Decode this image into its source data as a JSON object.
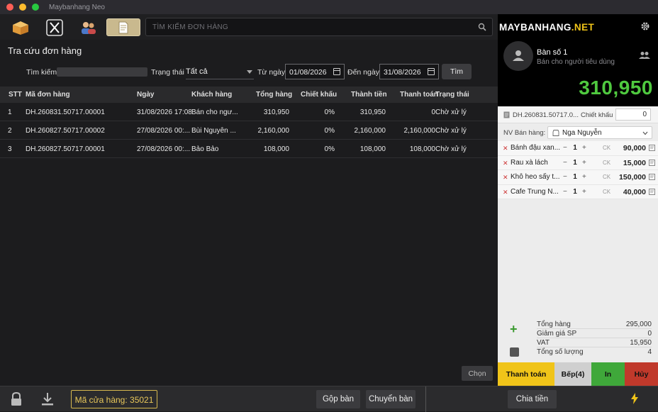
{
  "window": {
    "title": "Maybanhang Neo"
  },
  "toolbar": {
    "search_placeholder": "TÌM KIẾM ĐƠN HÀNG",
    "icons": [
      "box-icon",
      "utensils-icon",
      "users-icon",
      "orders-icon",
      "search-icon"
    ]
  },
  "page": {
    "title": "Tra cứu đơn hàng"
  },
  "filters": {
    "keyword_label": "Tìm kiếm",
    "status_label": "Trạng thái",
    "status_value": "Tất cả",
    "from_label": "Từ ngày",
    "from_value": "01/08/2026",
    "to_label": "Đến ngày",
    "to_value": "31/08/2026",
    "search_button": "Tìm"
  },
  "table": {
    "headers": [
      "STT",
      "Mã đơn hàng",
      "Ngày",
      "Khách hàng",
      "Tổng hàng",
      "Chiết khấu",
      "Thành tiền",
      "Thanh toán",
      "Trạng thái"
    ],
    "rows": [
      {
        "stt": "1",
        "code": "DH.260831.50717.00001",
        "date": "31/08/2026 17:08",
        "customer": "Bán cho ngư...",
        "subtotal": "310,950",
        "discount": "0%",
        "total": "310,950",
        "paid": "0",
        "status": "Chờ xử lý"
      },
      {
        "stt": "2",
        "code": "DH.260827.50717.00002",
        "date": "27/08/2026 00:...",
        "customer": "Bùi Nguyễn ...",
        "subtotal": "2,160,000",
        "discount": "0%",
        "total": "2,160,000",
        "paid": "2,160,000",
        "status": "Chờ xử lý"
      },
      {
        "stt": "3",
        "code": "DH.260827.50717.00001",
        "date": "27/08/2026 00:...",
        "customer": "Bảo Bảo",
        "subtotal": "108,000",
        "discount": "0%",
        "total": "108,000",
        "paid": "108,000",
        "status": "Chờ xử lý"
      }
    ],
    "select_button": "Chọn"
  },
  "bottom": {
    "store_code": "Mã cửa hàng: 35021",
    "merge_button": "Gộp bàn",
    "transfer_button": "Chuyển bàn",
    "split_button": "Chia tiền"
  },
  "panel": {
    "brand_main": "MAYBANHANG",
    "brand_suffix": ".NET",
    "table_name": "Bàn số 1",
    "customer": "Bán cho người tiêu dùng",
    "grand_total": "310,950",
    "order_code": "DH.260831.50717.0...",
    "discount_label": "Chiết khấu",
    "discount_value": "0",
    "staff_label": "NV Bán hàng:",
    "staff_value": "Nga Nguyễn",
    "items": [
      {
        "name": "Bánh đậu xan...",
        "qty": "1",
        "ck": "CK",
        "price": "90,000"
      },
      {
        "name": "Rau xà lách",
        "qty": "1",
        "ck": "CK",
        "price": "15,000"
      },
      {
        "name": "Khô heo sấy t...",
        "qty": "1",
        "ck": "CK",
        "price": "150,000"
      },
      {
        "name": "Cafe Trung N...",
        "qty": "1",
        "ck": "CK",
        "price": "40,000"
      }
    ],
    "summary": {
      "subtotal_label": "Tổng hàng",
      "subtotal": "295,000",
      "item_discount_label": "Giảm giá SP",
      "item_discount": "0",
      "vat_label": "VAT",
      "vat": "15,950",
      "qty_label": "Tổng số lượng",
      "qty": "4"
    },
    "actions": {
      "pay": "Thanh toán",
      "kitchen": "Bếp(4)",
      "print": "In",
      "cancel": "Hủy"
    },
    "colors": {
      "total": "#4fc93f",
      "pay": "#f0c419",
      "kitchen": "#cfcfcf",
      "print": "#3fa83a",
      "cancel": "#c0392b"
    }
  }
}
